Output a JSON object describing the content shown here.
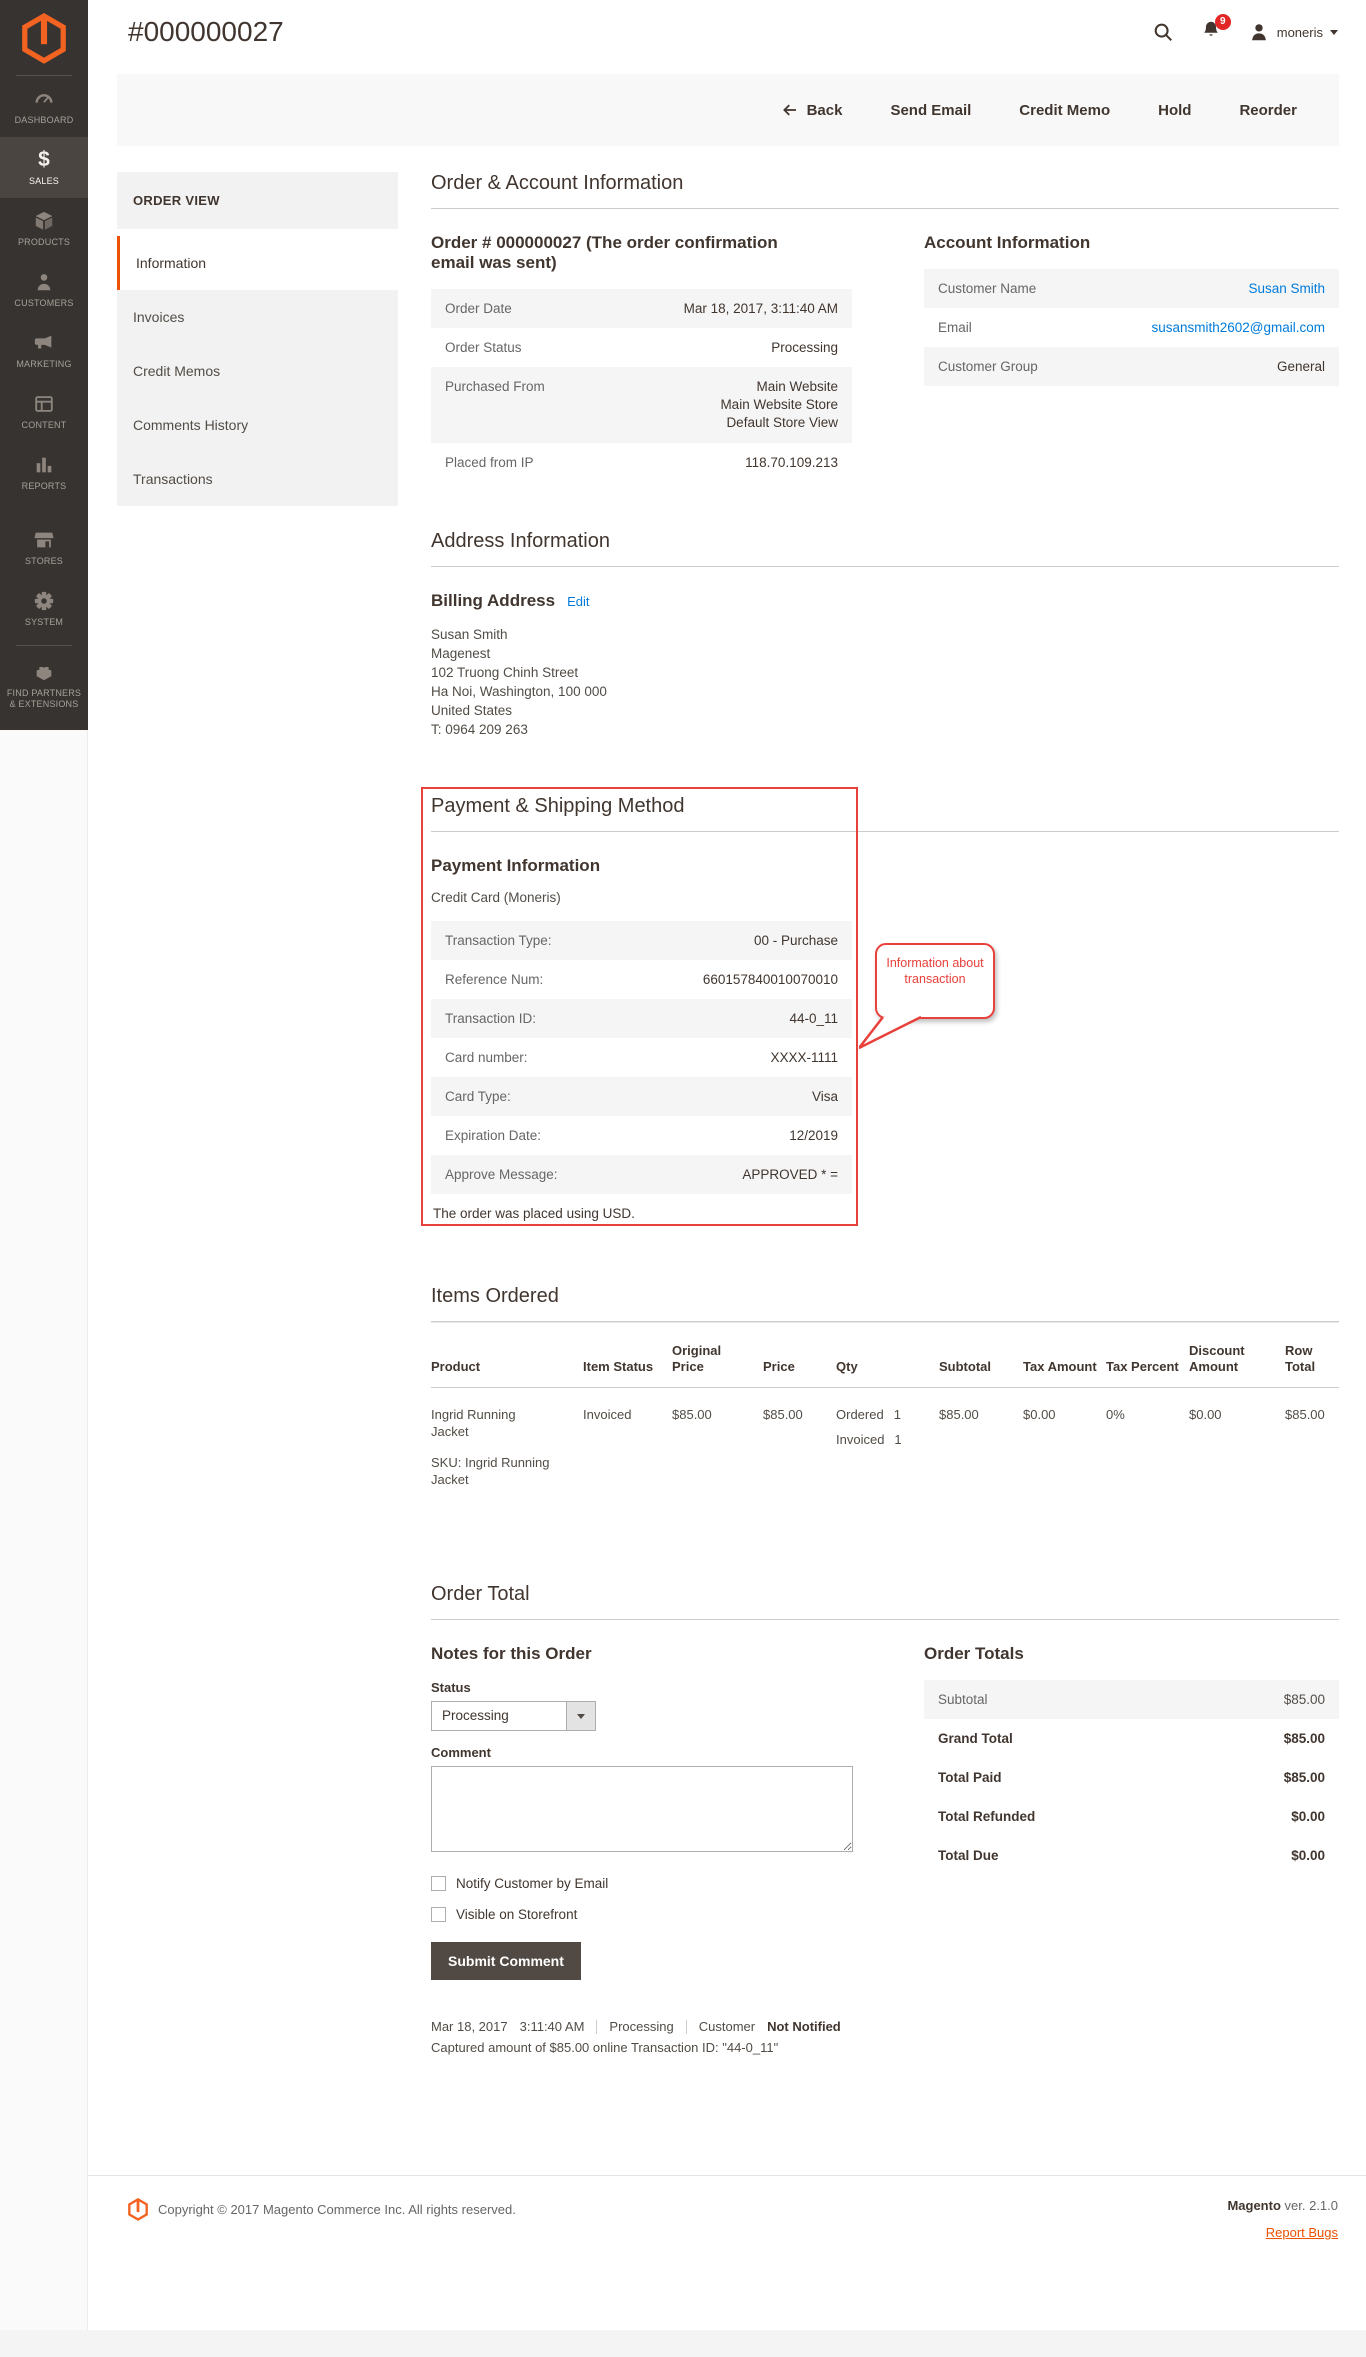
{
  "app": {
    "page_title": "#000000027",
    "user_name": "moneris",
    "notification_count": "9"
  },
  "sidebar": {
    "items": [
      {
        "label": "DASHBOARD"
      },
      {
        "label": "SALES"
      },
      {
        "label": "PRODUCTS"
      },
      {
        "label": "CUSTOMERS"
      },
      {
        "label": "MARKETING"
      },
      {
        "label": "CONTENT"
      },
      {
        "label": "REPORTS"
      },
      {
        "label": "STORES"
      },
      {
        "label": "SYSTEM"
      },
      {
        "label": "FIND PARTNERS & EXTENSIONS"
      }
    ]
  },
  "actions": {
    "back": "Back",
    "send_email": "Send Email",
    "credit_memo": "Credit Memo",
    "hold": "Hold",
    "reorder": "Reorder"
  },
  "order_nav": {
    "title": "ORDER VIEW",
    "active": "Information",
    "items": [
      "Invoices",
      "Credit Memos",
      "Comments History",
      "Transactions"
    ]
  },
  "order_account": {
    "heading": "Order & Account Information",
    "order_title": "Order # 000000027 (The order confirmation email was sent)",
    "rows": [
      {
        "label": "Order Date",
        "value": "Mar 18, 2017, 3:11:40 AM"
      },
      {
        "label": "Order Status",
        "value": "Processing"
      },
      {
        "label": "Purchased From",
        "lines": [
          "Main Website",
          "Main Website Store",
          "Default Store View"
        ]
      },
      {
        "label": "Placed from IP",
        "value": "118.70.109.213"
      }
    ],
    "account_title": "Account Information",
    "account_rows": [
      {
        "label": "Customer Name",
        "value": "Susan Smith"
      },
      {
        "label": "Email",
        "value": "susansmith2602@gmail.com"
      },
      {
        "label": "Customer Group",
        "value": "General"
      }
    ]
  },
  "address": {
    "heading": "Address Information",
    "billing_title": "Billing Address",
    "edit_link": "Edit",
    "lines": [
      "Susan Smith",
      "Magenest",
      "102 Truong Chinh Street",
      "Ha Noi, Washington, 100 000",
      "United States",
      "T: 0964 209 263"
    ]
  },
  "payment": {
    "heading": "Payment & Shipping Method",
    "title": "Payment Information",
    "method": "Credit Card (Moneris)",
    "rows": [
      {
        "label": "Transaction Type:",
        "value": "00 - Purchase"
      },
      {
        "label": "Reference Num:",
        "value": "660157840010070010"
      },
      {
        "label": "Transaction ID:",
        "value": "44-0_11"
      },
      {
        "label": "Card number:",
        "value": "XXXX-1111"
      },
      {
        "label": "Card Type:",
        "value": "Visa"
      },
      {
        "label": "Expiration Date:",
        "value": "12/2019"
      },
      {
        "label": "Approve Message:",
        "value": "APPROVED * ="
      }
    ],
    "currency_note": "The order was placed using USD.",
    "callout": "Information about transaction"
  },
  "items_ordered": {
    "heading": "Items Ordered",
    "columns": [
      "Product",
      "Item Status",
      "Original Price",
      "Price",
      "Qty",
      "Subtotal",
      "Tax Amount",
      "Tax Percent",
      "Discount Amount",
      "Row Total"
    ],
    "row": {
      "product_name": "Ingrid Running Jacket",
      "product_sku": "SKU: Ingrid Running Jacket",
      "item_status": "Invoiced",
      "original_price": "$85.00",
      "price": "$85.00",
      "qty_lines": [
        {
          "label": "Ordered",
          "value": "1"
        },
        {
          "label": "Invoiced",
          "value": "1"
        }
      ],
      "subtotal": "$85.00",
      "tax_amount": "$0.00",
      "tax_percent": "0%",
      "discount_amount": "$0.00",
      "row_total": "$85.00"
    }
  },
  "order_total": {
    "heading": "Order Total",
    "notes_title": "Notes for this Order",
    "status_label": "Status",
    "status_value": "Processing",
    "comment_label": "Comment",
    "notify_label": "Notify Customer by Email",
    "visible_label": "Visible on Storefront",
    "submit_label": "Submit Comment",
    "totals_title": "Order Totals",
    "totals": [
      {
        "label": "Subtotal",
        "value": "$85.00"
      },
      {
        "label": "Grand Total",
        "value": "$85.00"
      },
      {
        "label": "Total Paid",
        "value": "$85.00"
      },
      {
        "label": "Total Refunded",
        "value": "$0.00"
      },
      {
        "label": "Total Due",
        "value": "$0.00"
      }
    ]
  },
  "history": {
    "date": "Mar 18, 2017",
    "time": "3:11:40 AM",
    "status": "Processing",
    "customer_prefix": "Customer",
    "customer_status": "Not Notified",
    "detail": "Captured amount of $85.00 online Transaction ID: \"44-0_11\""
  },
  "footer": {
    "copyright": "Copyright © 2017 Magento Commerce Inc. All rights reserved.",
    "brand": "Magento",
    "version": " ver. 2.1.0",
    "report_bugs": "Report Bugs"
  },
  "colors": {
    "accent_orange": "#eb5202",
    "logo_orange": "#f26322",
    "link_blue": "#007bdb",
    "annotation_red": "#e8403a",
    "sidebar_bg": "#373330",
    "sidebar_active_bg": "#4a4540",
    "button_dark": "#514943"
  }
}
